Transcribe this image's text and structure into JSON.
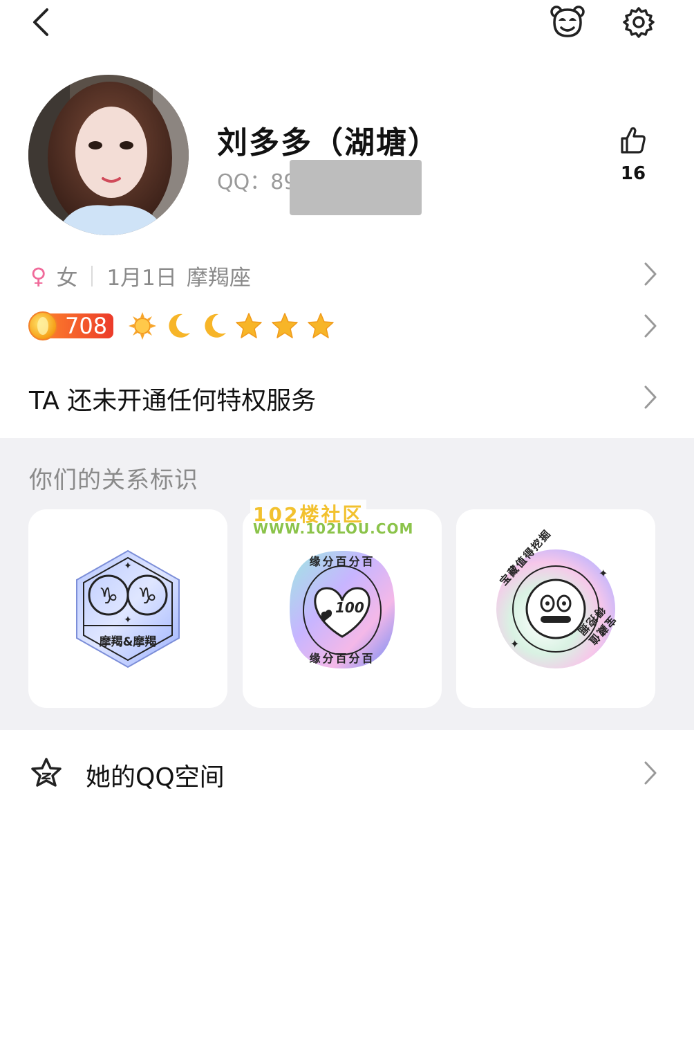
{
  "header": {
    "back_icon": "chevron-left-icon",
    "pet_icon": "panda-face-icon",
    "settings_icon": "gear-icon"
  },
  "profile": {
    "name": "刘多多（湖塘）",
    "qq_label": "QQ：89",
    "likes": "16",
    "gender_symbol": "♀",
    "gender": "女",
    "birthday": "1月1日",
    "zodiac": "摩羯座"
  },
  "level": {
    "value": "708",
    "icons": [
      "sun-icon",
      "moon-icon",
      "moon-icon",
      "star-icon",
      "star-icon",
      "star-icon"
    ]
  },
  "privilege": {
    "text": "TA 还未开通任何特权服务"
  },
  "relations": {
    "title": "你们的关系标识",
    "cards": [
      {
        "label": "摩羯&摩羯"
      },
      {
        "label_top": "缘分百分百",
        "label_bottom": "缘分百分百",
        "number": "100"
      },
      {
        "label_top": "宝藏值得挖掘",
        "label_bottom": "宝藏值得挖掘"
      }
    ]
  },
  "watermark": {
    "line1": "102楼社区",
    "line2": "WWW.102LOU.COM"
  },
  "qzone": {
    "label": "她的QQ空间"
  },
  "colors": {
    "accent_pink": "#f06a9a",
    "level_orange": "#f1582c",
    "star_gold": "#f5b31c"
  }
}
